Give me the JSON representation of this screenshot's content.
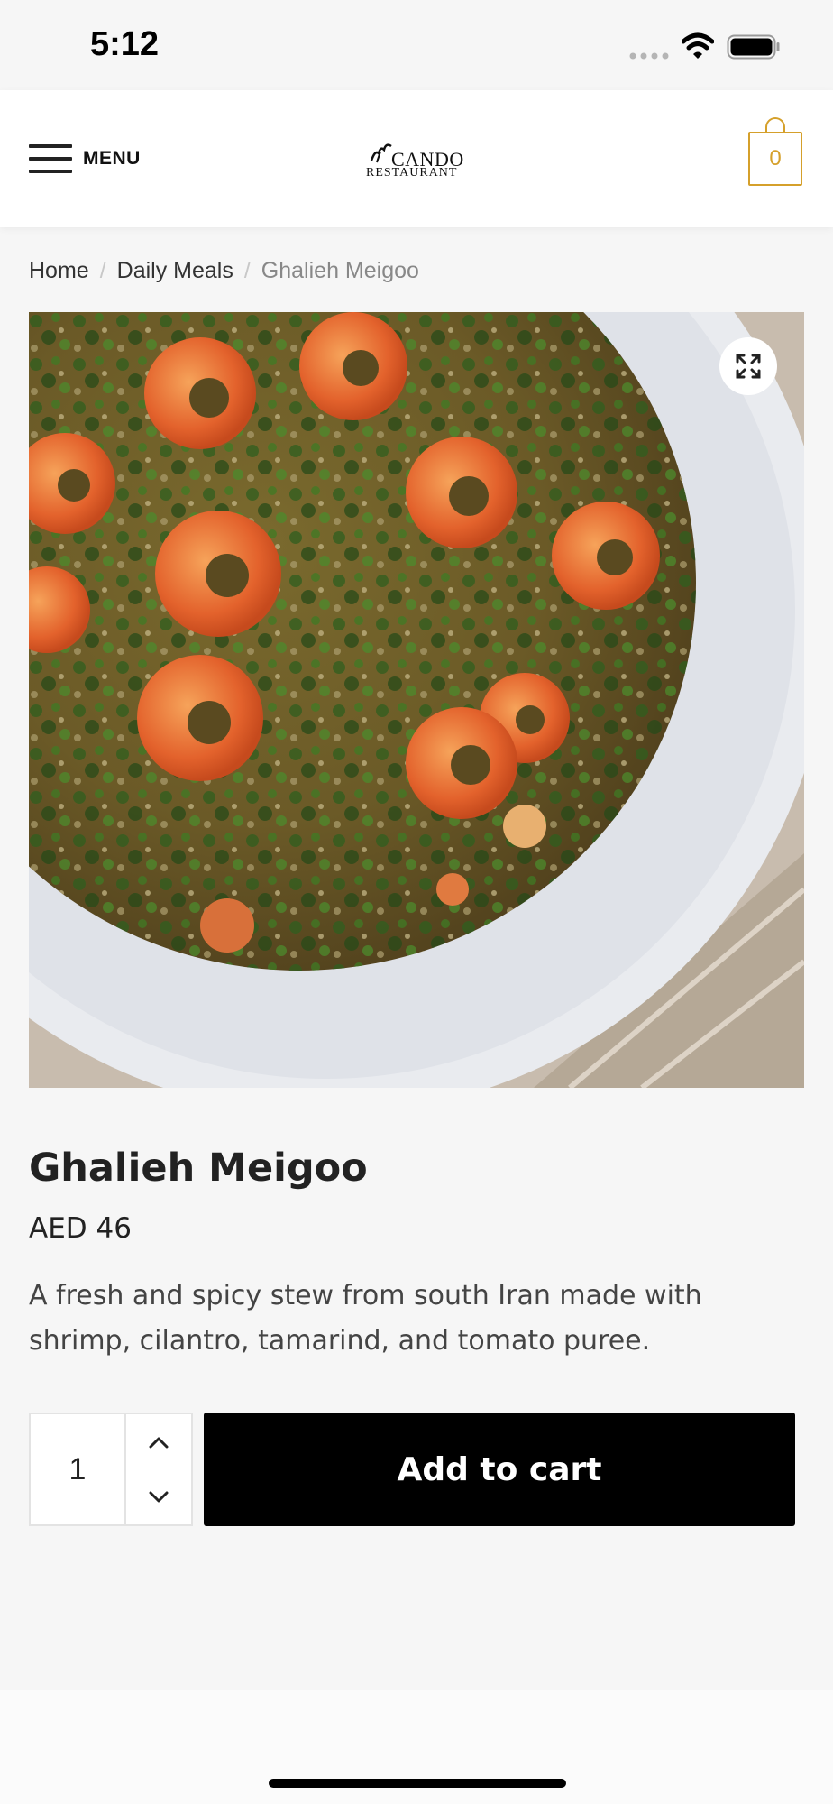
{
  "status_bar": {
    "time": "5:12",
    "icons": [
      "signal-icon",
      "wifi-icon",
      "battery-icon"
    ]
  },
  "header": {
    "menu_label": "MENU",
    "logo_name": "CANDO",
    "logo_sub": "RESTAURANT",
    "cart_count": "0",
    "accent_color": "#d5a02b"
  },
  "breadcrumb": {
    "items": [
      "Home",
      "Daily Meals"
    ],
    "separator": "/",
    "current": "Ghalieh Meigoo"
  },
  "product": {
    "image_icon": "expand-icon",
    "title": "Ghalieh Meigoo",
    "price": "AED 46",
    "description": "A fresh and spicy stew from south Iran made with shrimp, cilantro, tamarind, and tomato puree."
  },
  "cart_form": {
    "quantity": "1",
    "add_to_cart_label": "Add to cart",
    "button_color": "#000000"
  }
}
